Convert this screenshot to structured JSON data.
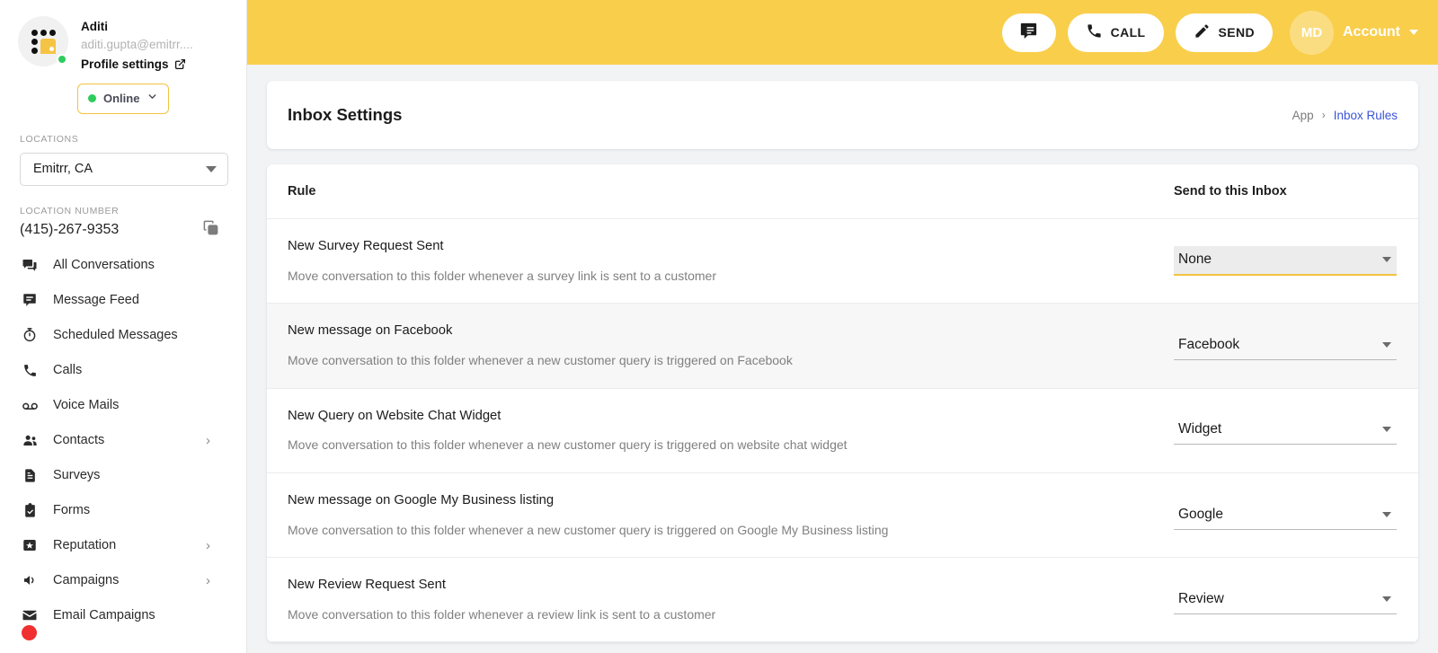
{
  "sidebar": {
    "profile": {
      "name": "Aditi",
      "email": "aditi.gupta@emitrr....",
      "settings_link": "Profile settings",
      "status": "Online"
    },
    "locations_label": "LOCATIONS",
    "location_selected": "Emitrr, CA",
    "location_number_label": "LOCATION NUMBER",
    "location_number": "(415)-267-9353",
    "items": [
      {
        "label": "All Conversations",
        "icon": "conversations-icon",
        "has_arrow": false
      },
      {
        "label": "Message Feed",
        "icon": "message-feed-icon",
        "has_arrow": false
      },
      {
        "label": "Scheduled Messages",
        "icon": "clock-icon",
        "has_arrow": false
      },
      {
        "label": "Calls",
        "icon": "phone-icon",
        "has_arrow": false
      },
      {
        "label": "Voice Mails",
        "icon": "voicemail-icon",
        "has_arrow": false
      },
      {
        "label": "Contacts",
        "icon": "contacts-icon",
        "has_arrow": true
      },
      {
        "label": "Surveys",
        "icon": "survey-document-icon",
        "has_arrow": false
      },
      {
        "label": "Forms",
        "icon": "forms-clipboard-icon",
        "has_arrow": false
      },
      {
        "label": "Reputation",
        "icon": "reputation-star-icon",
        "has_arrow": true
      },
      {
        "label": "Campaigns",
        "icon": "campaigns-megaphone-icon",
        "has_arrow": true
      },
      {
        "label": "Email Campaigns",
        "icon": "email-envelope-icon",
        "has_arrow": false
      }
    ]
  },
  "topbar": {
    "chat_button": "chat-icon",
    "call_label": "CALL",
    "send_label": "SEND",
    "account_initials": "MD",
    "account_label": "Account"
  },
  "page": {
    "title": "Inbox Settings",
    "breadcrumb_root": "App",
    "breadcrumb_sep": "›",
    "breadcrumb_current": "Inbox Rules"
  },
  "table": {
    "col_rule": "Rule",
    "col_inbox": "Send to this Inbox",
    "rows": [
      {
        "title": "New Survey Request Sent",
        "description": "Move conversation to this folder whenever a survey link is sent to a customer",
        "inbox": "None"
      },
      {
        "title": "New message on Facebook",
        "description": "Move conversation to this folder whenever a new customer query is triggered on Facebook",
        "inbox": "Facebook"
      },
      {
        "title": "New Query on Website Chat Widget",
        "description": "Move conversation to this folder whenever a new customer query is triggered on website chat widget",
        "inbox": "Widget"
      },
      {
        "title": "New message on Google My Business listing",
        "description": "Move conversation to this folder whenever a new customer query is triggered on Google My Business listing",
        "inbox": "Google"
      },
      {
        "title": "New Review Request Sent",
        "description": "Move conversation to this folder whenever a review link is sent to a customer",
        "inbox": "Review"
      }
    ]
  },
  "colors": {
    "brand_yellow": "#f9ce4b",
    "accent_yellow": "#f3c33f",
    "link_blue": "#3b54d6",
    "online_green": "#2ecc5b",
    "badge_red": "#f03030"
  }
}
